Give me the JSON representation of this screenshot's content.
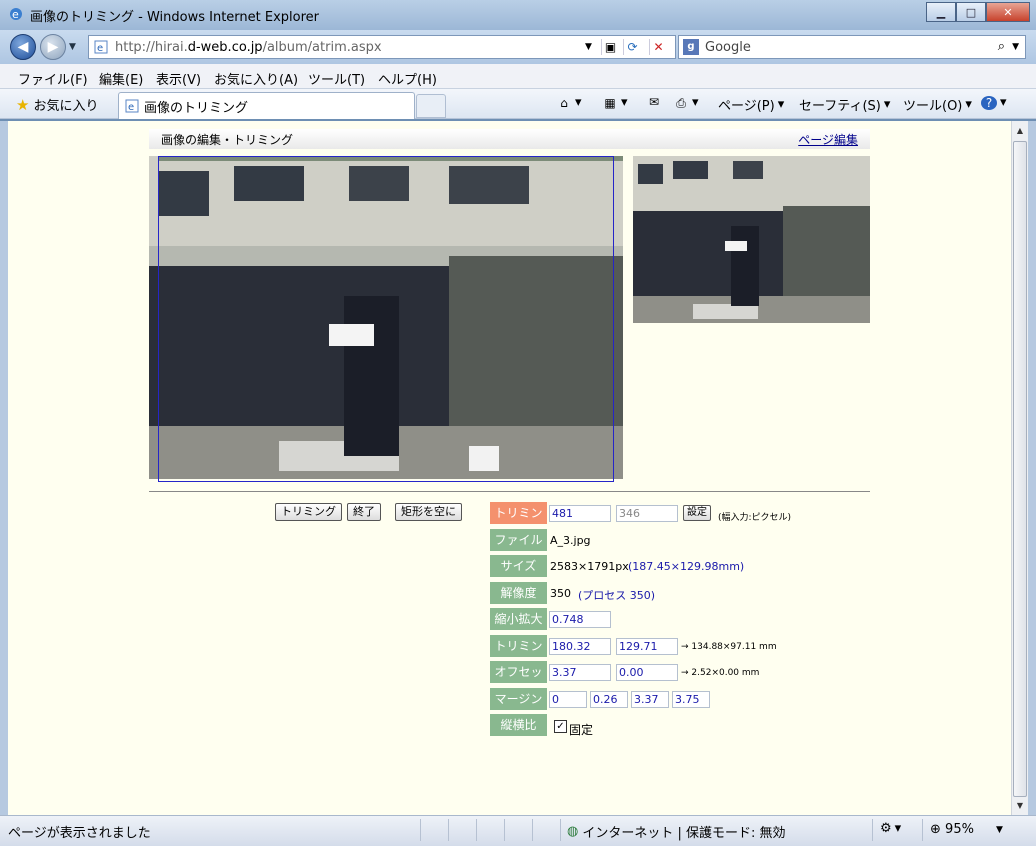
{
  "window": {
    "title": "画像のトリミング - Windows Internet Explorer",
    "minimize": "▁",
    "maximize": "□",
    "close": "✕"
  },
  "address": {
    "url_prefix": "http://hirai.",
    "url_host": "d-web.co.jp",
    "url_path": "/album/atrim.aspx",
    "search_placeholder": "Google"
  },
  "menu": [
    "ファイル(F)",
    "編集(E)",
    "表示(V)",
    "お気に入り(A)",
    "ツール(T)",
    "ヘルプ(H)"
  ],
  "favbar": {
    "favorites": "お気に入り",
    "tab_title": "画像のトリミング",
    "page": "ページ(P)",
    "safety": "セーフティ(S)",
    "tools": "ツール(O)"
  },
  "page": {
    "header_title": "画像の編集・トリミング",
    "header_link": "ページ編集",
    "buttons": {
      "trim": "トリミング",
      "end": "終了",
      "rect_empty": "矩形を空に"
    },
    "form": {
      "trim_label": "トリミング",
      "trim_w": "481",
      "trim_h": "346",
      "set_button": "設定",
      "trim_note": "(幅入力:ピクセル)",
      "file_label": "ファイル名",
      "file_value": "A_3.jpg",
      "size_label": "サイズ",
      "size_px": "2583×1791px",
      "size_mm": "(187.45×129.98mm)",
      "res_label": "解像度",
      "res_value": "350",
      "res_process": "(プロセス 350)",
      "scale_label": "縮小拡大",
      "scale_value": "0.748",
      "trim2_label": "トリミング",
      "trim2_w": "180.32",
      "trim2_h": "129.71",
      "trim2_result": "→ 134.88×97.11 mm",
      "offset_label": "オフセット",
      "offset_x": "3.37",
      "offset_y": "0.00",
      "offset_result": "→ 2.52×0.00 mm",
      "margin_label": "マージン",
      "margin_1": "0",
      "margin_2": "0.26",
      "margin_3": "3.37",
      "margin_4": "3.75",
      "aspect_label": "縦横比",
      "aspect_fixed": "固定"
    }
  },
  "status": {
    "message": "ページが表示されました",
    "zone": "インターネット | 保護モード: 無効",
    "zoom": "95%"
  },
  "colors": {
    "label_green": "#89b88f",
    "label_orange": "#f4916d",
    "page_bg": "#fffff0",
    "crop_border": "#2525c8"
  }
}
